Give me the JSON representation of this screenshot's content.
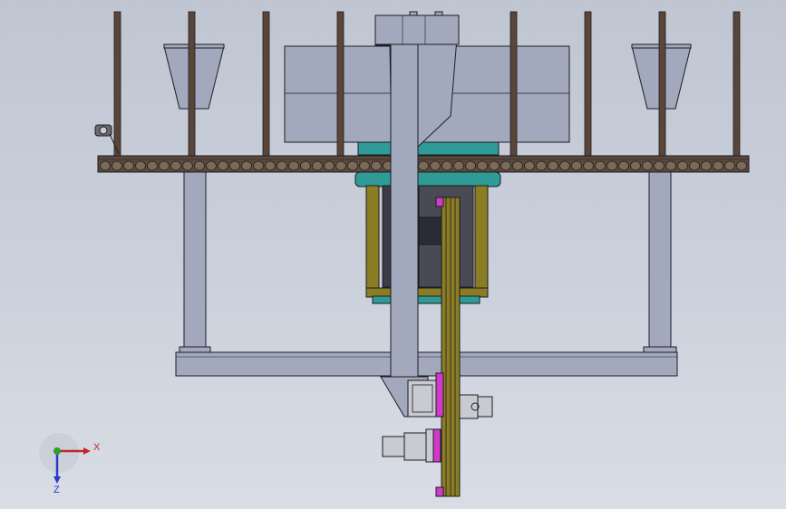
{
  "view": {
    "background_top": "#bfc6d2",
    "background_bottom": "#d9dde5"
  },
  "triad": {
    "x_label": "X",
    "z_label": "Z",
    "x_color": "#c0282a",
    "y_color": "#2aa02a",
    "z_color": "#2a3acb"
  },
  "colors": {
    "frame": "#a3a9bd",
    "frame_dark": "#8d93a8",
    "post": "#5a4538",
    "conveyor": "#5b4a3c",
    "roller": "#7a6a58",
    "chain": "#8a7d24",
    "teal": "#2f9b96",
    "magenta": "#d03ac8",
    "motor": "#c9cbd1",
    "edge": "#1c1c22"
  }
}
